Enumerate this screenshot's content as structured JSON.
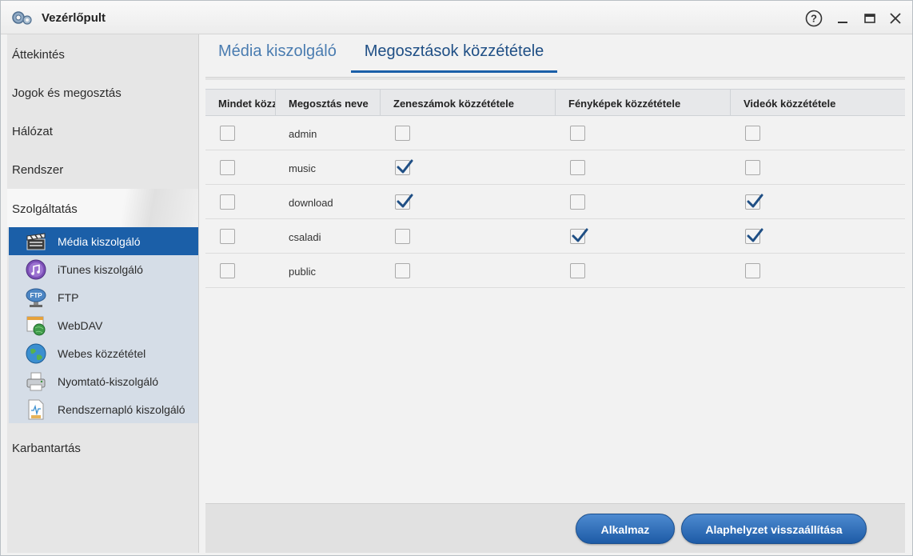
{
  "window": {
    "title": "Vezérlőpult"
  },
  "sidebar": {
    "sections": [
      {
        "label": "Áttekintés"
      },
      {
        "label": "Jogok és megosztás"
      },
      {
        "label": "Hálózat"
      },
      {
        "label": "Rendszer"
      },
      {
        "label": "Szolgáltatás"
      },
      {
        "label": "Karbantartás"
      }
    ],
    "service_items": [
      {
        "label": "Média kiszolgáló",
        "icon": "clapperboard-icon",
        "active": true
      },
      {
        "label": "iTunes kiszolgáló",
        "icon": "itunes-icon"
      },
      {
        "label": "FTP",
        "icon": "ftp-globe-icon"
      },
      {
        "label": "WebDAV",
        "icon": "webdav-icon"
      },
      {
        "label": "Webes közzététel",
        "icon": "globe-icon"
      },
      {
        "label": "Nyomtató-kiszolgáló",
        "icon": "printer-icon"
      },
      {
        "label": "Rendszernapló kiszolgáló",
        "icon": "log-document-icon"
      }
    ]
  },
  "tabs": [
    {
      "label": "Média kiszolgáló",
      "active": false
    },
    {
      "label": "Megosztások közzététele",
      "active": true
    }
  ],
  "table": {
    "headers": [
      "Mindet közzé",
      "Megosztás neve",
      "Zeneszámok közzététele",
      "Fényképek közzététele",
      "Videók közzététele"
    ],
    "rows": [
      {
        "all": false,
        "name": "admin",
        "music": false,
        "photos": false,
        "videos": false
      },
      {
        "all": false,
        "name": "music",
        "music": true,
        "photos": false,
        "videos": false
      },
      {
        "all": false,
        "name": "download",
        "music": true,
        "photos": false,
        "videos": true
      },
      {
        "all": false,
        "name": "csaladi",
        "music": false,
        "photos": true,
        "videos": true
      },
      {
        "all": false,
        "name": "public",
        "music": false,
        "photos": false,
        "videos": false
      }
    ]
  },
  "buttons": {
    "apply": "Alkalmaz",
    "reset": "Alaphelyzet visszaállítása"
  },
  "colors": {
    "accent": "#1b5fa8",
    "check": "#1f4f85"
  }
}
